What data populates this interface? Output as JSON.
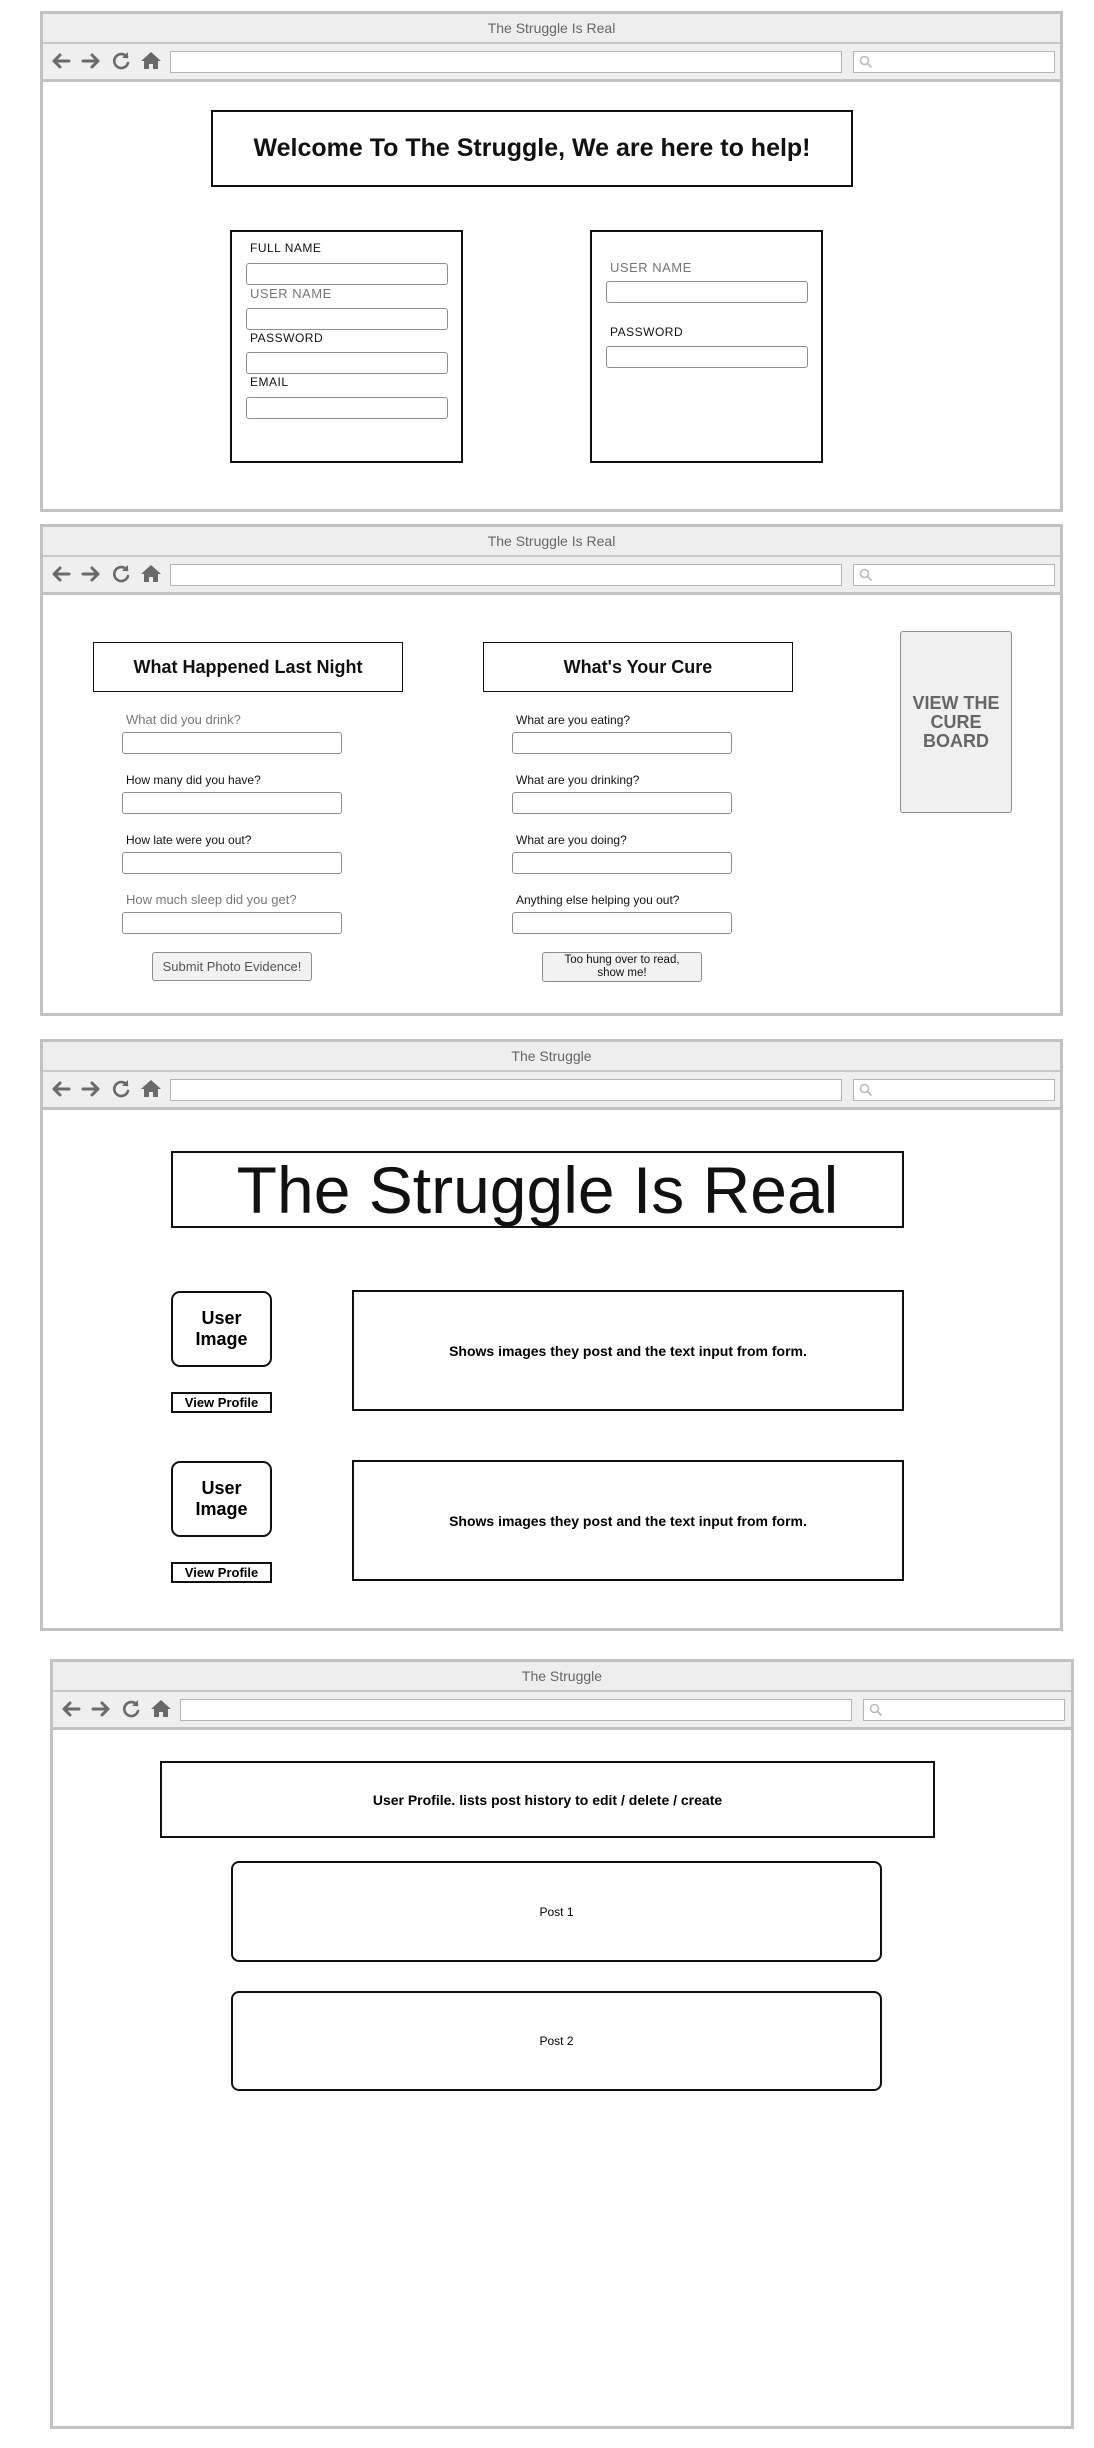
{
  "icons": {
    "back": "arrow-left-icon",
    "forward": "arrow-right-icon",
    "reload": "reload-icon",
    "home": "home-icon",
    "search": "search-icon"
  },
  "colors": {
    "chrome": "#eeeeee",
    "border": "#c2c2c2",
    "icon": "#6a6a6a",
    "ink": "#111111"
  },
  "window1": {
    "title": "The Struggle Is Real",
    "heading": "Welcome To The Struggle, We are here to help!",
    "signup": {
      "full_name_label": "FULL NAME",
      "user_name_label": "USER NAME",
      "password_label": "PASSWORD",
      "email_label": "EMAIL"
    },
    "login": {
      "user_name_label": "USER NAME",
      "password_label": "PASSWORD"
    }
  },
  "window2": {
    "title": "The Struggle Is Real",
    "last_night": {
      "heading": "What Happened Last Night",
      "q1": "What did you drink?",
      "q2": "How many did you have?",
      "q3": "How late were you out?",
      "q4": "How much sleep did you get?",
      "submit_label": "Submit Photo Evidence!"
    },
    "cure": {
      "heading": "What's Your Cure",
      "q1": "What are you eating?",
      "q2": "What are you drinking?",
      "q3": "What are you doing?",
      "q4": "Anything else helping you out?",
      "button_line1": "Too hung over to read,",
      "button_line2": "show me!"
    },
    "cure_board_button": {
      "line1": "VIEW THE",
      "line2": "CURE",
      "line3": "BOARD"
    }
  },
  "window3": {
    "title": "The Struggle",
    "banner": "The Struggle Is Real",
    "posts": [
      {
        "image_line1": "User",
        "image_line2": "Image",
        "profile_button": "View Profile",
        "content": "Shows images they post and the text input from form."
      },
      {
        "image_line1": "User",
        "image_line2": "Image",
        "profile_button": "View Profile",
        "content": "Shows images they post and the text input from form."
      }
    ]
  },
  "window4": {
    "title": "The Struggle",
    "heading": "User Profile. lists post history to edit / delete / create",
    "posts": [
      "Post 1",
      "Post 2"
    ]
  }
}
